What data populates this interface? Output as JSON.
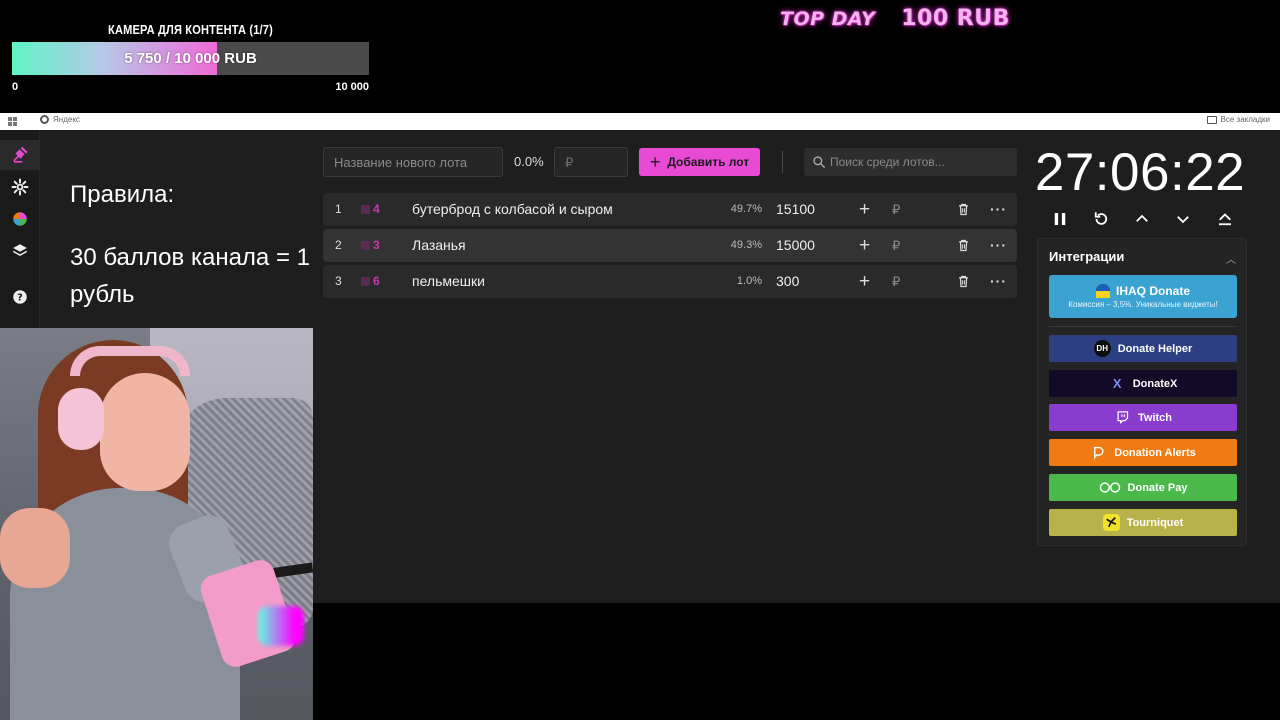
{
  "overlay": {
    "goal": {
      "title": "КАМЕРА ДЛЯ КОНТЕНТА (1/7)",
      "progress_text": "5 750 / 10 000 RUB",
      "current": 5750,
      "target": 10000,
      "min_label": "0",
      "max_label": "10 000"
    },
    "top_day": {
      "label": "TOP DAY",
      "amount": "100 RUB"
    }
  },
  "browser": {
    "bookmark_yandex": "Яндекс",
    "bookmark_all": "Все закладки"
  },
  "rules": {
    "title": "Правила:",
    "text": "30 баллов канала = 1 рубль"
  },
  "toolbar": {
    "lot_name_placeholder": "Название нового лота",
    "total_percent": "0.0%",
    "amount_placeholder": "₽",
    "add_button_label": "Добавить лот",
    "search_placeholder": "Поиск среди лотов..."
  },
  "lots": [
    {
      "index": "1",
      "id": "4",
      "title": "бутерброд с колбасой и сыром",
      "percent": "49.7%",
      "amount": "15100"
    },
    {
      "index": "2",
      "id": "3",
      "title": "Лазанья",
      "percent": "49.3%",
      "amount": "15000"
    },
    {
      "index": "3",
      "id": "6",
      "title": "пельмешки",
      "percent": "1.0%",
      "amount": "300"
    }
  ],
  "lot_row_symbols": {
    "plus": "+",
    "currency": "₽",
    "more": "···"
  },
  "timer": {
    "value": "27:06:22"
  },
  "integrations": {
    "title": "Интеграции",
    "ihaq": {
      "name": "IHAQ Donate",
      "subtitle": "Комиссия – 3,5%. Уникальные виджеты!"
    },
    "buttons": [
      {
        "label": "Donate Helper",
        "color": "#2c3f82",
        "icon": "DH"
      },
      {
        "label": "DonateX",
        "color": "#120a26",
        "icon": "X"
      },
      {
        "label": "Twitch",
        "color": "#8a3ccf",
        "icon": "twitch-icon"
      },
      {
        "label": "Donation Alerts",
        "color": "#f07b12",
        "icon": "donation-alerts-icon"
      },
      {
        "label": "Donate Pay",
        "color": "#4bb84a",
        "icon": "donate-pay-icon"
      },
      {
        "label": "Tourniquet",
        "color": "#b9b14a",
        "icon": "tourniquet-icon"
      }
    ]
  },
  "colors": {
    "accent": "#e94ad5",
    "background": "#1e1e1e"
  }
}
